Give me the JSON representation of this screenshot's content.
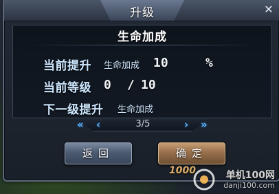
{
  "dialog": {
    "title": "升级",
    "close_icon": "close-icon"
  },
  "panel": {
    "title": "生命加成",
    "current_boost_label": "当前提升",
    "current_boost_stat": "生命加成",
    "current_boost_value": "10",
    "current_boost_unit": "%",
    "current_level_label": "当前等级",
    "current_level_value": "0",
    "level_separator": "/",
    "max_level_value": "10",
    "next_boost_label": "下一级提升",
    "next_boost_stat": "生命加成"
  },
  "pager": {
    "first_icon": "double-chevron-left-icon",
    "first_glyph": "«",
    "prev_icon": "chevron-left-icon",
    "prev_glyph": "‹",
    "page_text": "3/5",
    "next_icon": "chevron-right-icon",
    "next_glyph": "›",
    "last_icon": "double-chevron-right-icon",
    "last_glyph": "»"
  },
  "buttons": {
    "back_label": "返回",
    "confirm_label": "确定"
  },
  "watermark": {
    "logo_number": "1000",
    "brand": "单机100网",
    "url": "danji100.com"
  },
  "colors": {
    "label_blue": "#cfe8ff",
    "arrow_blue": "#5fb4ff",
    "confirm_gold": "#97704c",
    "back_steel": "#4c5b72"
  }
}
